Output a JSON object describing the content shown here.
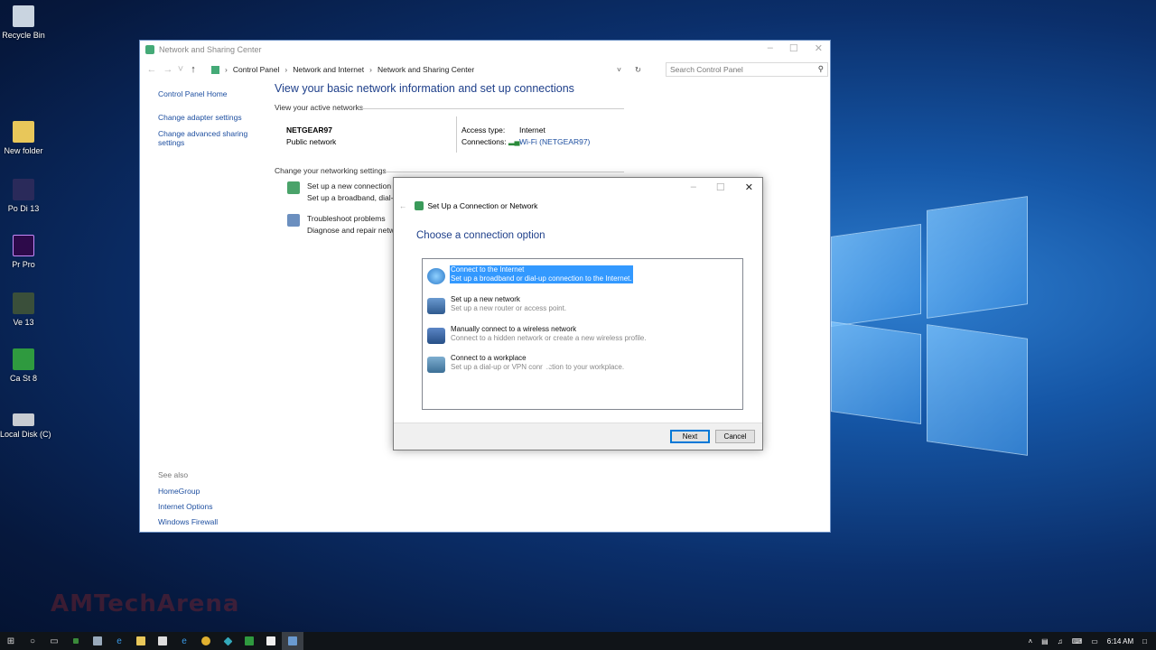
{
  "desktop": {
    "icons": [
      "Recycle Bin",
      "New folder",
      "Po Di 13",
      "Pr Pro",
      "Ve 13",
      "Ca St 8",
      "Local Disk (C)"
    ],
    "watermark": "AMTechArena"
  },
  "window": {
    "title": "Network and Sharing Center",
    "breadcrumb": [
      "Control Panel",
      "Network and Internet",
      "Network and Sharing Center"
    ],
    "search_placeholder": "Search Control Panel",
    "left_links": [
      "Control Panel Home",
      "Change adapter settings",
      "Change advanced sharing settings"
    ],
    "see_also_header": "See also",
    "see_also": [
      "HomeGroup",
      "Internet Options",
      "Windows Firewall"
    ],
    "heading": "View your basic network information and set up connections",
    "active_networks_label": "View your active networks",
    "network": {
      "name": "NETGEAR97",
      "type": "Public network",
      "access_type_label": "Access type:",
      "access_type_value": "Internet",
      "connections_label": "Connections:",
      "connections_value": "Wi-Fi (NETGEAR97)"
    },
    "change_settings_label": "Change your networking settings",
    "tasks": [
      {
        "title": "Set up a new connection or",
        "desc": "Set up a broadband, dial-up"
      },
      {
        "title": "Troubleshoot problems",
        "desc": "Diagnose and repair networ"
      }
    ]
  },
  "dialog": {
    "title": "Set Up a Connection or Network",
    "heading": "Choose a connection option",
    "options": [
      {
        "title": "Connect to the Internet",
        "desc": "Set up a broadband or dial-up connection to the Internet."
      },
      {
        "title": "Set up a new network",
        "desc": "Set up a new router or access point."
      },
      {
        "title": "Manually connect to a wireless network",
        "desc": "Connect to a hidden network or create a new wireless profile."
      },
      {
        "title": "Connect to a workplace",
        "desc": "Set up a dial-up or VPN connection to your workplace."
      }
    ],
    "next_label": "Next",
    "cancel_label": "Cancel"
  },
  "taskbar": {
    "clock": "6:14 AM"
  },
  "colors": {
    "link": "#1e4fa0",
    "heading": "#1e3f8a",
    "selection": "#3399ff"
  }
}
